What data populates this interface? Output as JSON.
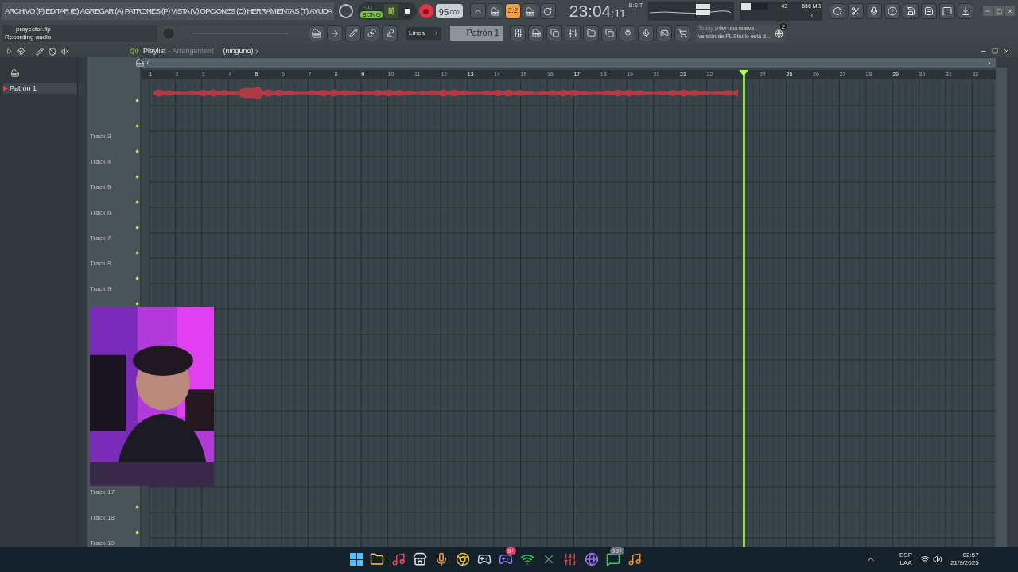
{
  "menu": [
    {
      "label": "ARCHIVO (F)"
    },
    {
      "label": "EDITAR (E)"
    },
    {
      "label": "AGREGAR (A)"
    },
    {
      "label": "PATRONES (P)"
    },
    {
      "label": "VISTA (V)"
    },
    {
      "label": "OPCIONES (O)"
    },
    {
      "label": "HERRAMIENTAS (T)"
    },
    {
      "label": "AYUDA"
    }
  ],
  "transport": {
    "modes": [
      {
        "label": "PAT",
        "selected": false
      },
      {
        "label": "SONG",
        "selected": true
      }
    ],
    "playing": true,
    "recording": true,
    "tempo": "95",
    "tempo_fraction": ".000",
    "snap_value": "3.2",
    "time": "23:04",
    "time_ticks": ":11",
    "time_format": "B:S:T"
  },
  "monitor": {
    "cpu": "43",
    "memory": "666 MB",
    "polyphony": "0"
  },
  "project": {
    "file": "proyector.flp",
    "hint": "Recording audio"
  },
  "toolbar2": {
    "snap": "Línea",
    "pattern": "Patrón 1"
  },
  "news": {
    "day": "Today",
    "text": "¡Hay una nueva versión de FL Studio está d...",
    "badge": "2"
  },
  "playlist": {
    "title": "Playlist",
    "subtitle": "- Arrangement",
    "arrangement": "(ninguno)",
    "patterns": [
      {
        "label": "Patrón 1",
        "selected": true
      }
    ],
    "ruler_before": [
      "1",
      "2",
      "3",
      "4",
      "5",
      "6",
      "7",
      "8",
      "9",
      "10",
      "11",
      "12",
      "13",
      "14",
      "15",
      "16",
      "17",
      "18",
      "19",
      "20",
      "21",
      "22"
    ],
    "ruler_after": [
      "24",
      "25",
      "26",
      "27",
      "28",
      "29",
      "30",
      "31",
      "32"
    ],
    "playhead": {
      "level": 0.7
    },
    "tracks_upper": [
      "Track 3",
      "Track 4",
      "Track 5",
      "Track 6",
      "Track 7",
      "Track 8",
      "Track 9"
    ],
    "tracks_lower": [
      "Track 17",
      "Track 18",
      "Track 19"
    ]
  },
  "taskbar": {
    "badges": [
      "9+",
      "99+"
    ],
    "language": "ESP",
    "layout": "LAA",
    "time": "02:57",
    "date": "21/9/2025"
  }
}
